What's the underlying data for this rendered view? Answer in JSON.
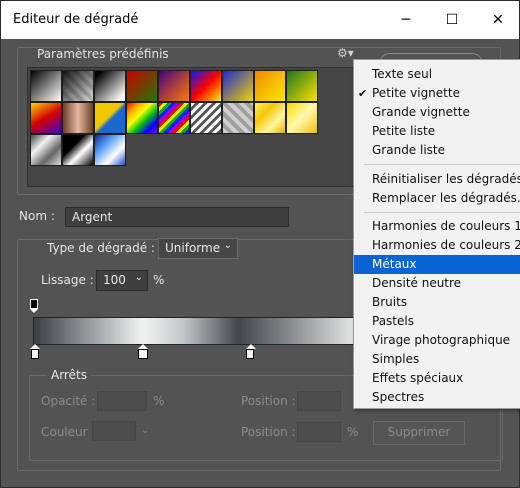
{
  "window": {
    "title": "Editeur de dégradé",
    "minimize": "─",
    "maximize": "☐",
    "close": "✕"
  },
  "presets": {
    "label": "Paramètres prédéfinis",
    "gear": "⚙▾"
  },
  "name": {
    "label": "Nom :",
    "value": "Argent"
  },
  "gradient_type": {
    "label": "Type de dégradé :",
    "value": "Uniforme"
  },
  "smoothness": {
    "label": "Lissage :",
    "value": "100",
    "unit": "%"
  },
  "stops": {
    "title": "Arrêts",
    "opacity_label": "Opacité :",
    "opacity_unit": "%",
    "position_label": "Position :",
    "position_unit": "%",
    "color_label": "Couleur :",
    "color_position_label": "Position :",
    "color_position_unit": "%",
    "delete_button": "Supprimer"
  },
  "menu": {
    "items": [
      {
        "label": "Texte seul"
      },
      {
        "label": "Petite vignette",
        "checked": "✔"
      },
      {
        "label": "Grande vignette"
      },
      {
        "label": "Petite liste"
      },
      {
        "label": "Grande liste"
      },
      {
        "label": "Réinitialiser les dégradés..."
      },
      {
        "label": "Remplacer les dégradés..."
      },
      {
        "label": "Harmonies de couleurs 1"
      },
      {
        "label": "Harmonies de couleurs 2"
      },
      {
        "label": "Métaux"
      },
      {
        "label": "Densité neutre"
      },
      {
        "label": "Bruits"
      },
      {
        "label": "Pastels"
      },
      {
        "label": "Virage photographique"
      },
      {
        "label": "Simples"
      },
      {
        "label": "Effets spéciaux"
      },
      {
        "label": "Spectres"
      }
    ]
  },
  "colors": {
    "accent": "#0b64d6",
    "bg": "#535353"
  }
}
